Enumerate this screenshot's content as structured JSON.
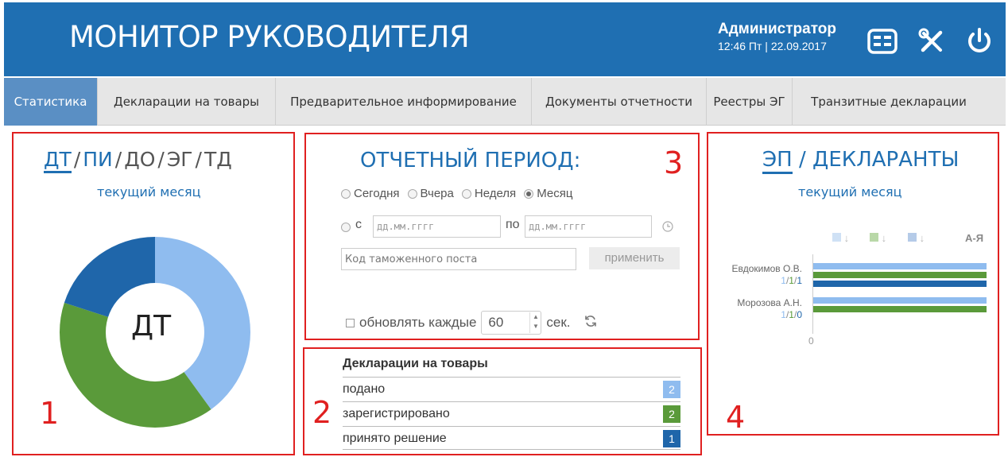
{
  "header": {
    "title": "МОНИТОР РУКОВОДИТЕЛЯ",
    "user": "Администратор",
    "datetime": "12:46 Пт | 22.09.2017",
    "icons": [
      "table-icon",
      "tools-icon",
      "power-icon"
    ]
  },
  "tabs": [
    {
      "label": "Статистика",
      "active": true
    },
    {
      "label": "Декларации на товары"
    },
    {
      "label": "Предварительное информирование"
    },
    {
      "label": "Документы отчетности"
    },
    {
      "label": "Реестры ЭГ"
    },
    {
      "label": "Транзитные декларации"
    }
  ],
  "panel1": {
    "number": "1",
    "links": [
      "ДТ",
      "ПИ",
      "ДО",
      "ЭГ",
      "ТД"
    ],
    "separator": "/",
    "subtitle": "текущий месяц",
    "center_label": "ДТ",
    "colors": {
      "light": "#8fbcef",
      "green": "#5a9a3a",
      "blue": "#1f66aa"
    },
    "donut_values": [
      2,
      2,
      1
    ]
  },
  "panel3": {
    "number": "3",
    "title": "ОТЧЕТНЫЙ ПЕРИОД:",
    "radios": [
      {
        "label": "Сегодня",
        "checked": false
      },
      {
        "label": "Вчера",
        "checked": false
      },
      {
        "label": "Неделя",
        "checked": false
      },
      {
        "label": "Месяц",
        "checked": true
      }
    ],
    "from_label": "с",
    "to_label": "по",
    "date_placeholder": "дд.мм.гггг",
    "post_placeholder": "Код таможенного поста",
    "apply": "применить",
    "refresh_label": "обновлять каждые",
    "refresh_value": "60",
    "refresh_unit": "сек."
  },
  "panel2": {
    "number": "2",
    "heading": "Декларации на товары",
    "rows": [
      {
        "label": "подано",
        "value": "2",
        "color": "#8fbcef"
      },
      {
        "label": "зарегистрировано",
        "value": "2",
        "color": "#5a9a3a"
      },
      {
        "label": "принято решение",
        "value": "1",
        "color": "#1f66aa"
      }
    ]
  },
  "panel4": {
    "number": "4",
    "title_active": "ЭП",
    "title_sep": "/",
    "title_rest": "ДЕКЛАРАНТЫ",
    "subtitle": "текущий месяц",
    "sort_alpha": "А-Я",
    "axis_zero": "0",
    "declarants": [
      {
        "name": "Евдокимов О.В.",
        "v1": "1",
        "v2": "1",
        "v3": "1",
        "sep": "/"
      },
      {
        "name": "Морозова А.Н.",
        "v1": "1",
        "v2": "1",
        "v3": "0",
        "sep": "/"
      }
    ]
  }
}
